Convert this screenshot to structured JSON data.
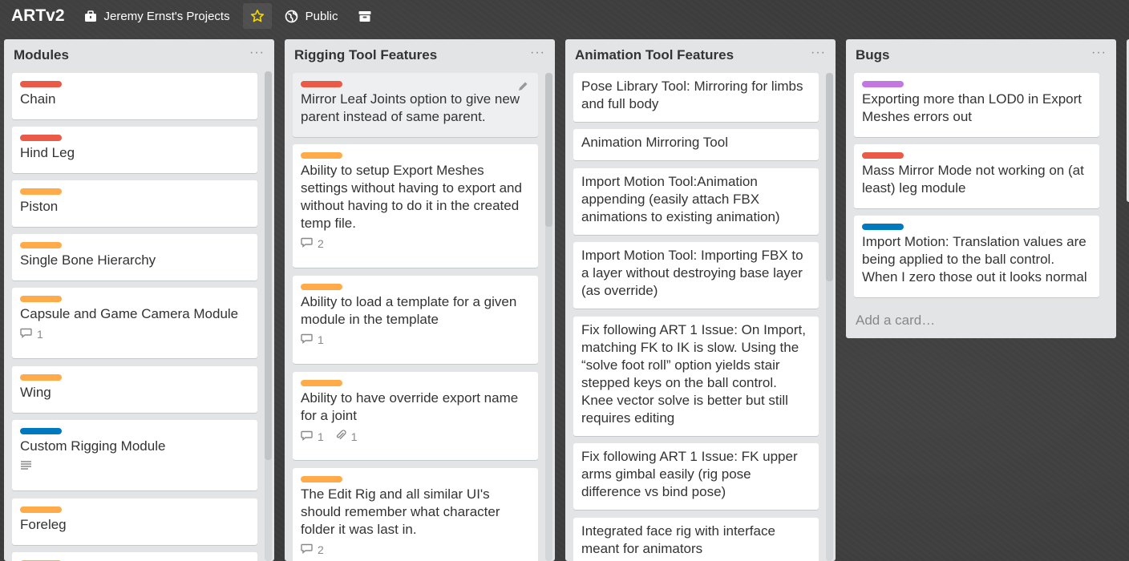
{
  "header": {
    "board_title": "ARTv2",
    "team_label": "Jeremy Ernst's Projects",
    "visibility_label": "Public"
  },
  "colors": {
    "red": "#eb5a46",
    "orange": "#ffab4a",
    "blue": "#0079bf",
    "purple": "#c377e0",
    "star": "#f2d600"
  },
  "lists": [
    {
      "title": "Modules",
      "cards": [
        {
          "label": "red",
          "text": "Chain"
        },
        {
          "label": "red",
          "text": "Hind Leg"
        },
        {
          "label": "orange",
          "text": "Piston"
        },
        {
          "label": "orange",
          "text": "Single Bone Hierarchy"
        },
        {
          "label": "orange",
          "text": "Capsule and Game Camera Module",
          "comments": "1"
        },
        {
          "label": "orange",
          "text": "Wing"
        },
        {
          "label": "blue",
          "text": "Custom Rigging Module",
          "description": true
        },
        {
          "label": "orange",
          "text": "Foreleg"
        }
      ]
    },
    {
      "title": "Rigging Tool Features",
      "cards": [
        {
          "label": "red",
          "text": "Mirror Leaf Joints option to give new parent instead of same parent."
        },
        {
          "label": "orange",
          "text": "Ability to setup Export Meshes settings without having to export and without having to do it in the created temp file.",
          "comments": "2"
        },
        {
          "label": "orange",
          "text": "Ability to load a template for a given module in the template",
          "comments": "1"
        },
        {
          "label": "orange",
          "text": "Ability to have override export name for a joint",
          "comments": "1",
          "attachments": "1"
        },
        {
          "label": "orange",
          "text": "The Edit Rig and all similar UI's should remember what character folder it was last in.",
          "comments": "2"
        }
      ]
    },
    {
      "title": "Animation Tool Features",
      "cards": [
        {
          "text": "Pose Library Tool: Mirroring for limbs and full body"
        },
        {
          "text": "Animation Mirroring Tool"
        },
        {
          "text": "Import Motion Tool:Animation appending (easily attach FBX animations to existing animation)"
        },
        {
          "text": "Import Motion Tool: Importing FBX to a layer without destroying base layer (as override)"
        },
        {
          "text": "Fix following ART 1 Issue: On Import, matching FK to IK is slow. Using the “solve foot roll” option yields stair stepped keys on the ball control. Knee vector solve is better but still requires editing"
        },
        {
          "text": "Fix following ART 1 Issue: FK upper arms gimbal easily (rig pose difference vs bind pose)"
        },
        {
          "text": "Integrated face rig with interface meant for animators"
        }
      ]
    },
    {
      "title": "Bugs",
      "cards": [
        {
          "label": "purple",
          "text": "Exporting more than LOD0 in Export Meshes errors out"
        },
        {
          "label": "red",
          "text": "Mass Mirror Mode not working on (at least) leg module"
        },
        {
          "label": "blue",
          "text": "Import Motion: Translation values are being applied to the ball control. When I zero those out it looks normal"
        }
      ],
      "add_card_label": "Add a card…"
    }
  ]
}
